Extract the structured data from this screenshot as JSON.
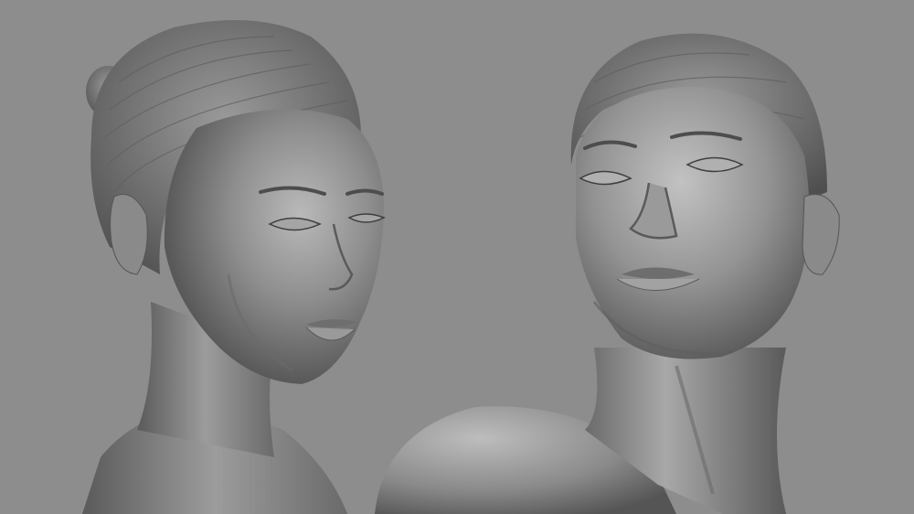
{
  "scene": {
    "background_color": "#8d8d8d",
    "material_color": "#7a7a7a",
    "subjects": [
      {
        "name": "sculpted-head-left"
      },
      {
        "name": "sculpted-head-right"
      }
    ]
  }
}
